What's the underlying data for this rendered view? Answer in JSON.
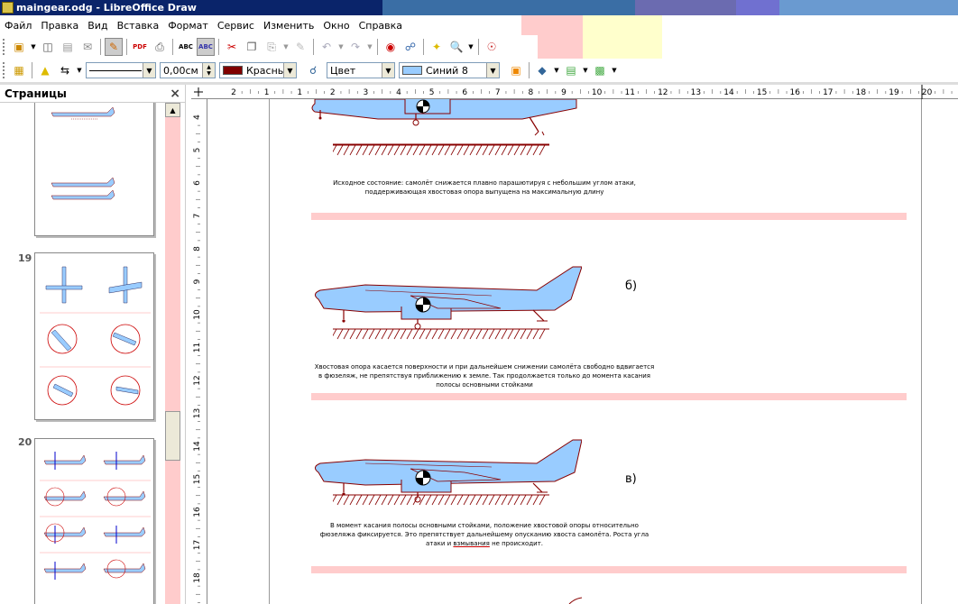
{
  "window": {
    "title": "maingear.odg - LibreOffice Draw"
  },
  "menu": [
    "Файл",
    "Правка",
    "Вид",
    "Вставка",
    "Формат",
    "Сервис",
    "Изменить",
    "Окно",
    "Справка"
  ],
  "line_toolbar": {
    "line_width": "0,00см",
    "line_color": "Красный",
    "fill_type": "Цвет",
    "fill_color": "Синий 8",
    "line_color_hex": "#800000",
    "fill_color_hex": "#99ccff"
  },
  "panel": {
    "title": "Страницы",
    "close": "×",
    "slides": [
      {
        "number": ""
      },
      {
        "number": "19"
      },
      {
        "number": "20"
      }
    ]
  },
  "ruler": {
    "h_ticks": [
      "2",
      "1",
      "1",
      "2",
      "3",
      "4",
      "5",
      "6",
      "7",
      "8",
      "9",
      "10",
      "11",
      "12",
      "13",
      "14",
      "15",
      "16",
      "17",
      "18",
      "19",
      "20"
    ],
    "v_ticks": [
      "4",
      "5",
      "6",
      "7",
      "8",
      "9",
      "10",
      "11",
      "12",
      "13",
      "14",
      "15",
      "16",
      "17",
      "18"
    ]
  },
  "document": {
    "caption_a": "Исходное состояние: самолёт снижается плавно парашютируя с небольшим углом атаки, поддерживающая хвостовая опора выпущена на максимальную длину",
    "label_b": "б)",
    "caption_b": "Хвостовая опора касается поверхности и при дальнейшем снижении самолёта свободно вдвигается в фюзеляж, не препятствуя приближению к земле. Так продолжается только до момента касания полосы основными стойками",
    "label_c": "в)",
    "caption_c_1": "В момент касания полосы основными стойками, положение хвостовой опоры относительно фюзеляжа фиксируется. Это препятствует дальнейшему опусканию хвоста самолёта. Роста угла атаки и",
    "caption_c_link": "взмывания",
    "caption_c_2": "не происходит."
  }
}
